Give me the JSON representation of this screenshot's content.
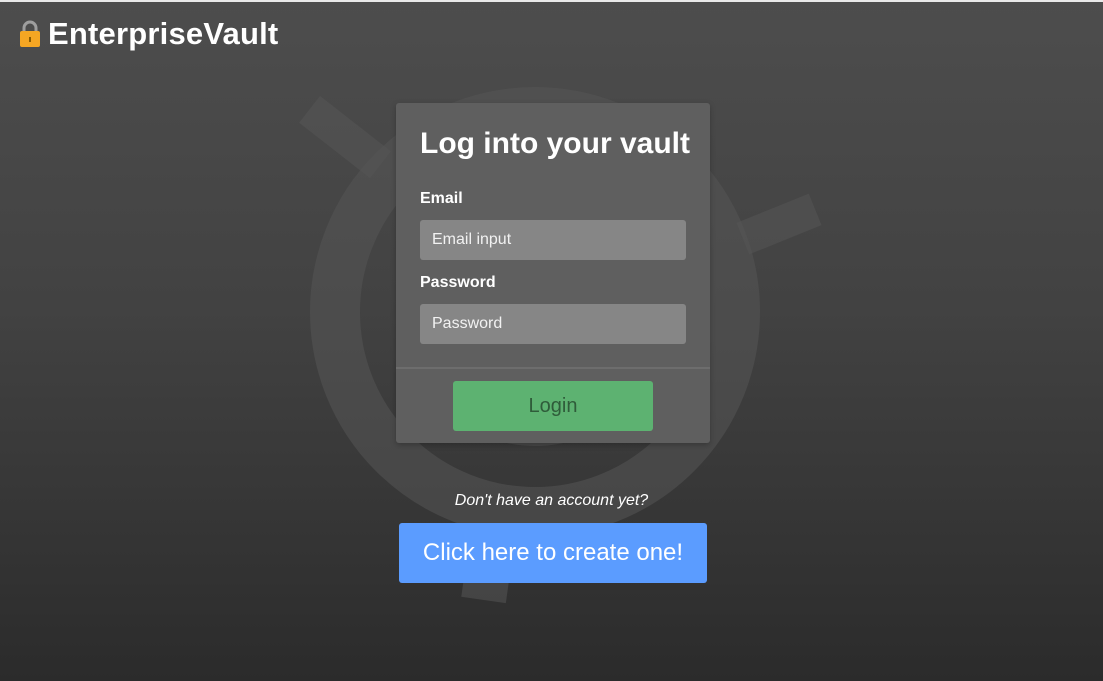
{
  "header": {
    "brand": "EnterpriseVault",
    "icon": "lock-icon"
  },
  "background": {
    "icon": "vault-dial-icon"
  },
  "login_card": {
    "title": "Log into your vault",
    "email_label": "Email",
    "email_placeholder": "Email input",
    "email_value": "",
    "password_label": "Password",
    "password_placeholder": "Password",
    "password_value": "",
    "login_button": "Login"
  },
  "signup": {
    "prompt": "Don't have an account yet?",
    "button": "Click here to create one!"
  },
  "colors": {
    "login_button": "#5db271",
    "signup_button": "#5b9cff",
    "card": "#5f5f5f",
    "lock": "#f5a623"
  }
}
